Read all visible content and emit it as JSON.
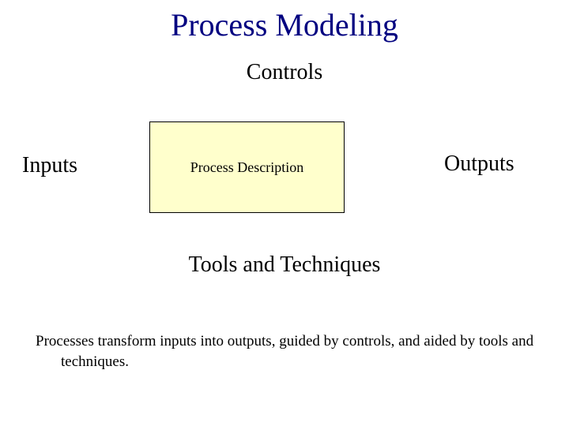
{
  "title": "Process Modeling",
  "labels": {
    "controls": "Controls",
    "inputs": "Inputs",
    "outputs": "Outputs",
    "process_box": "Process Description",
    "tools": "Tools and Techniques"
  },
  "description": "Processes transform inputs into outputs, guided by controls, and aided by tools and techniques."
}
